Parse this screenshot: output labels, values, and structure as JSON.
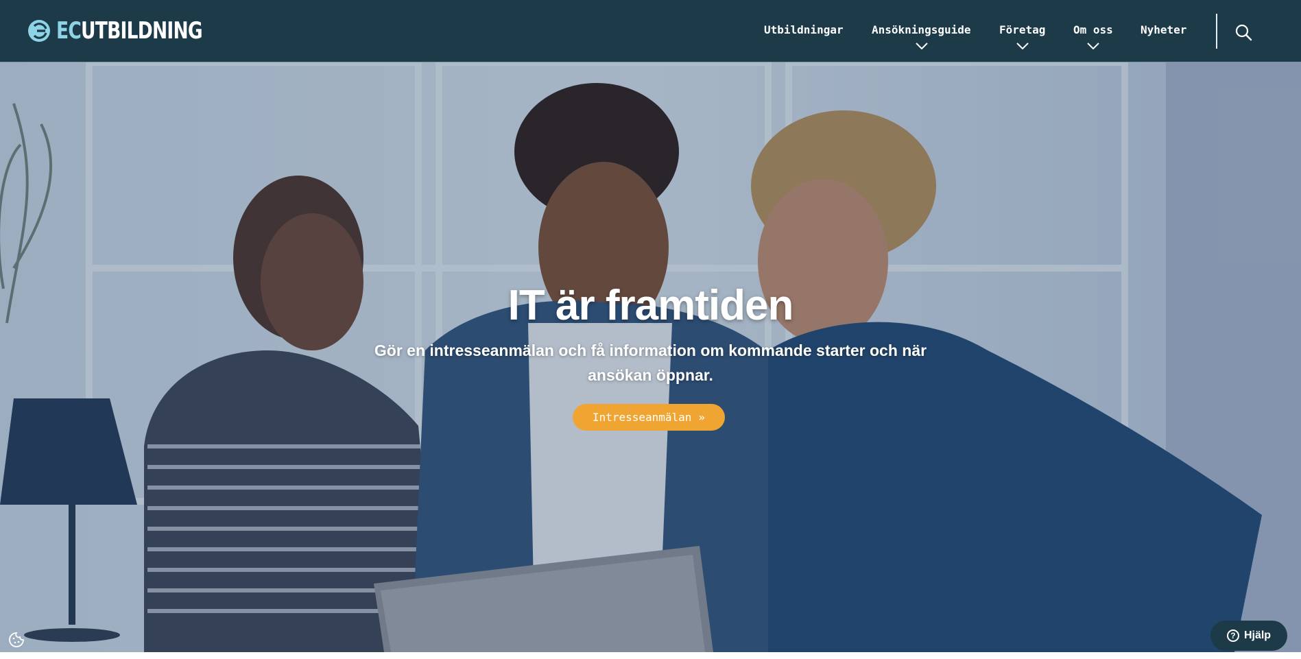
{
  "brand": {
    "logo_ec": "EC",
    "logo_rest": "UTBILDNING",
    "primary_color": "#1c3a48",
    "accent_color": "#8fd3e6",
    "cta_color": "#f0a532"
  },
  "nav": {
    "items": [
      {
        "label": "Utbildningar",
        "has_dropdown": false
      },
      {
        "label": "Ansökningsguide",
        "has_dropdown": true
      },
      {
        "label": "Företag",
        "has_dropdown": true
      },
      {
        "label": "Om oss",
        "has_dropdown": true
      },
      {
        "label": "Nyheter",
        "has_dropdown": false
      }
    ],
    "search_icon": "search-icon"
  },
  "hero": {
    "title": "IT är framtiden",
    "subtitle": "Gör en intresseanmälan och få information om kommande starter och när ansökan öppnar.",
    "cta_label": "Intresseanmälan",
    "cta_icon": "double-chevron-right-icon"
  },
  "widgets": {
    "cookie_icon": "cookie-icon",
    "help_label": "Hjälp",
    "help_icon": "question-circle-icon"
  }
}
